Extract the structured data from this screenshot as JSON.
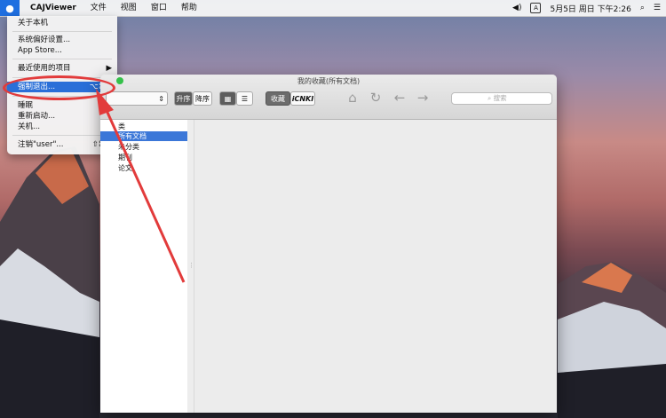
{
  "menubar": {
    "app_name": "CAJViewer",
    "menus": [
      "文件",
      "视图",
      "窗口",
      "帮助"
    ],
    "status": {
      "input": "A",
      "datetime": "5月5日 周日 下午2:26"
    }
  },
  "apple_menu": {
    "about": "关于本机",
    "prefs": "系统偏好设置...",
    "app_store": "App Store...",
    "recent": "最近使用的项目",
    "force_quit": "强制退出...",
    "force_quit_shortcut": "⌥⌘⎋",
    "sleep": "睡眠",
    "restart": "重新启动...",
    "shutdown": "关机...",
    "logout": "注销\"user\"...",
    "logout_shortcut": "⇧⌘Q"
  },
  "window": {
    "title": "我的收藏(所有文档)",
    "toolbar": {
      "sort_asc": "升序",
      "sort_desc": "降序",
      "collect": "收藏",
      "cnki": "iCNKI",
      "search_placeholder": "搜索"
    },
    "sidebar": {
      "header": "类",
      "items": [
        "所有文档",
        "未分类",
        "期刊",
        "论文"
      ]
    }
  },
  "colors": {
    "highlight": "#2a6fd8",
    "annotation": "#e23b3b"
  }
}
